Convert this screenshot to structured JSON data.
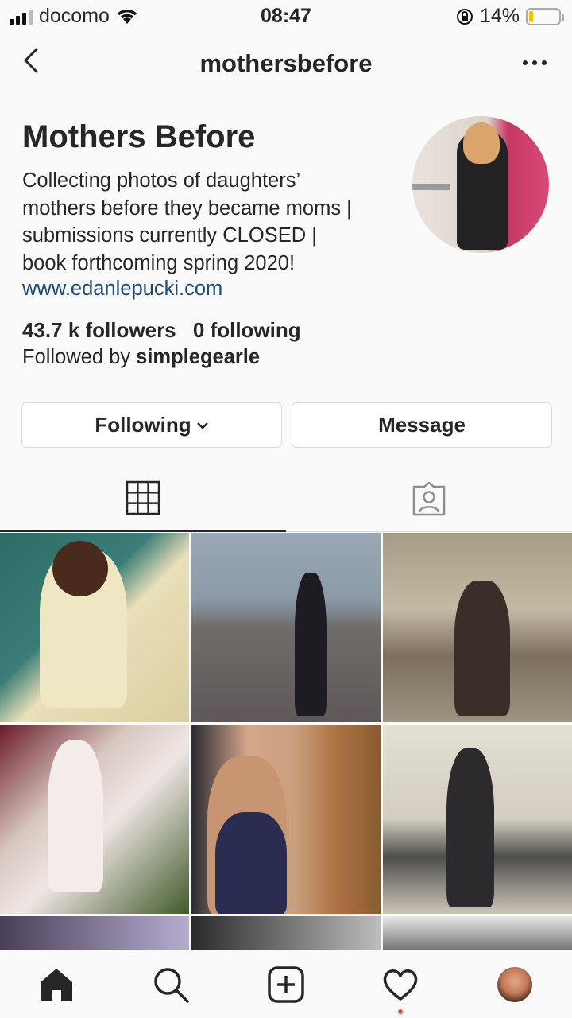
{
  "status": {
    "carrier": "docomo",
    "time": "08:47",
    "battery": "14%"
  },
  "navbar": {
    "title": "mothersbefore"
  },
  "profile": {
    "name": "Mothers Before",
    "bio_lines": [
      "Collecting photos of daughters’",
      "mothers before they became moms |",
      "submissions currently CLOSED |",
      "book forthcoming spring 2020!"
    ],
    "link": "www.edanlepucki.com",
    "followers": "43.7 k followers",
    "following": "0 following",
    "followed_by_prefix": "Followed by ",
    "followed_by_user": "simplegearle"
  },
  "buttons": {
    "following": "Following",
    "message": "Message"
  },
  "tabs": {
    "grid_icon": "grid-icon",
    "tagged_icon": "tagged-icon"
  },
  "grid": {
    "count": 9
  },
  "bottom_nav": {
    "icons": [
      "home-icon",
      "search-icon",
      "add-post-icon",
      "heart-icon",
      "profile-avatar"
    ]
  },
  "colors": {
    "link": "#1a4a7a",
    "notification_dot": "#ed4956",
    "battery": "#f5c400"
  }
}
